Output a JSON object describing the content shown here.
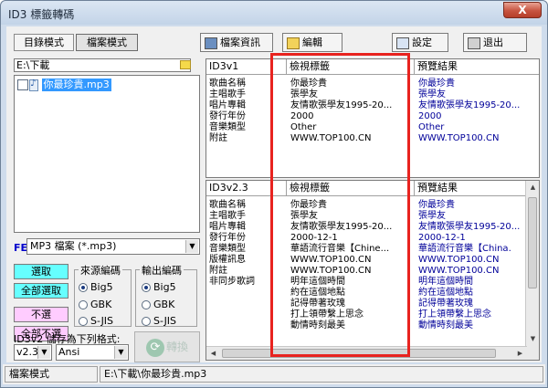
{
  "window": {
    "title": "ID3 標籤轉碼",
    "close_label": "X"
  },
  "mode_tabs": [
    {
      "label": "目錄模式"
    },
    {
      "label": "檔案模式"
    }
  ],
  "path": "E:\\下載",
  "files": [
    {
      "name": "你最珍貴.mp3"
    }
  ],
  "filter": {
    "label": "FE",
    "value": "MP3 檔案 (*.mp3)"
  },
  "select_buttons": [
    {
      "label": "選取"
    },
    {
      "label": "全部選取"
    },
    {
      "label": "不選"
    },
    {
      "label": "全部不選"
    }
  ],
  "source_encoding": {
    "title": "來源編碼",
    "options": [
      "Big5",
      "GBK",
      "S-JIS"
    ],
    "selected": "Big5"
  },
  "output_encoding": {
    "title": "輸出編碼",
    "options": [
      "Big5",
      "GBK",
      "S-JIS"
    ],
    "selected": "Big5"
  },
  "save_format": {
    "label": "ID3v2 儲存為下列格式:",
    "version": "v2.3",
    "charset": "Ansi"
  },
  "convert_button": {
    "label": "轉換"
  },
  "toolbar": {
    "file_info": "檔案資訊",
    "edit": "編輯",
    "settings": "設定",
    "exit": "退出"
  },
  "id3v1": {
    "header": "ID3v1",
    "view_header": "檢視標籤",
    "preview_header": "預覽結果",
    "rows": [
      {
        "field": "歌曲名稱",
        "view": "你最珍貴",
        "preview": "你最珍貴"
      },
      {
        "field": "主唱歌手",
        "view": "張學友",
        "preview": "張學友"
      },
      {
        "field": "唱片專輯",
        "view": "友情歌張學友1995-20...",
        "preview": "友情歌張學友1995-20..."
      },
      {
        "field": "發行年份",
        "view": "2000",
        "preview": "2000"
      },
      {
        "field": "音樂類型",
        "view": "Other",
        "preview": "Other"
      },
      {
        "field": "附註",
        "view": "WWW.TOP100.CN",
        "preview": "WWW.TOP100.CN"
      }
    ]
  },
  "id3v2": {
    "header": "ID3v2.3",
    "view_header": "檢視標籤",
    "preview_header": "預覽結果",
    "rows": [
      {
        "field": "歌曲名稱",
        "view": "你最珍貴",
        "preview": "你最珍貴"
      },
      {
        "field": "主唱歌手",
        "view": "張學友",
        "preview": "張學友"
      },
      {
        "field": "唱片專輯",
        "view": "友情歌張學友1995-20...",
        "preview": "友情歌張學友1995-20..."
      },
      {
        "field": "發行年份",
        "view": "2000-12-1",
        "preview": "2000-12-1"
      },
      {
        "field": "音樂類型",
        "view": "華語流行音樂【Chine...",
        "preview": "華語流行音樂【China."
      },
      {
        "field": "版權訊息",
        "view": "WWW.TOP100.CN",
        "preview": "WWW.TOP100.CN"
      },
      {
        "field": "附註",
        "view": "WWW.TOP100.CN",
        "preview": "WWW.TOP100.CN"
      },
      {
        "field": "非同步歌詞",
        "view": "明年這個時間",
        "preview": "明年這個時間"
      },
      {
        "field": "",
        "view": "約在這個地點",
        "preview": "約在這個地點"
      },
      {
        "field": "",
        "view": "記得帶著玫瑰",
        "preview": "記得帶著玫瑰"
      },
      {
        "field": "",
        "view": "打上領帶繫上思念",
        "preview": "打上領帶繫上思念"
      },
      {
        "field": "",
        "view": "動情時刻最美",
        "preview": "動情時刻最美"
      }
    ]
  },
  "status": {
    "mode": "檔案模式",
    "file_path": "E:\\下載\\你最珍貴.mp3"
  }
}
